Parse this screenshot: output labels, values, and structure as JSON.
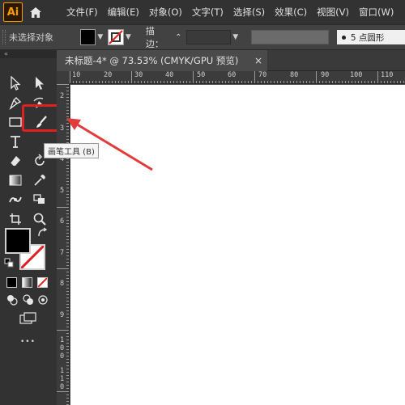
{
  "app": {
    "logo_text": "Ai"
  },
  "menu": {
    "items": [
      "文件(F)",
      "编辑(E)",
      "对象(O)",
      "文字(T)",
      "选择(S)",
      "效果(C)",
      "视图(V)",
      "窗口(W)"
    ]
  },
  "control_bar": {
    "selection_status": "未选择对象",
    "stroke_label": "描边：",
    "stroke_stepper": "⌃",
    "brush_definition": "5 点圆形"
  },
  "document": {
    "tab_title": "未标题-4* @ 73.53% (CMYK/GPU 预览)",
    "close_glyph": "×"
  },
  "rulers": {
    "top_ticks": [
      "10",
      "20",
      "30",
      "40",
      "50",
      "60",
      "70",
      "80",
      "90",
      "100",
      "110"
    ],
    "left_digits": [
      "2",
      "3",
      "4",
      "5",
      "6",
      "7",
      "8",
      "9",
      "1",
      "0",
      "0",
      "1",
      "1",
      "0"
    ]
  },
  "tooltip": {
    "text": "画笔工具 (B)"
  },
  "toolbar": {
    "collapse_glyph": "«",
    "more_glyph": "•••"
  },
  "colors": {
    "highlight": "#e02020",
    "arrow": "#e33a3a",
    "logo_accent": "#ff9a00"
  }
}
